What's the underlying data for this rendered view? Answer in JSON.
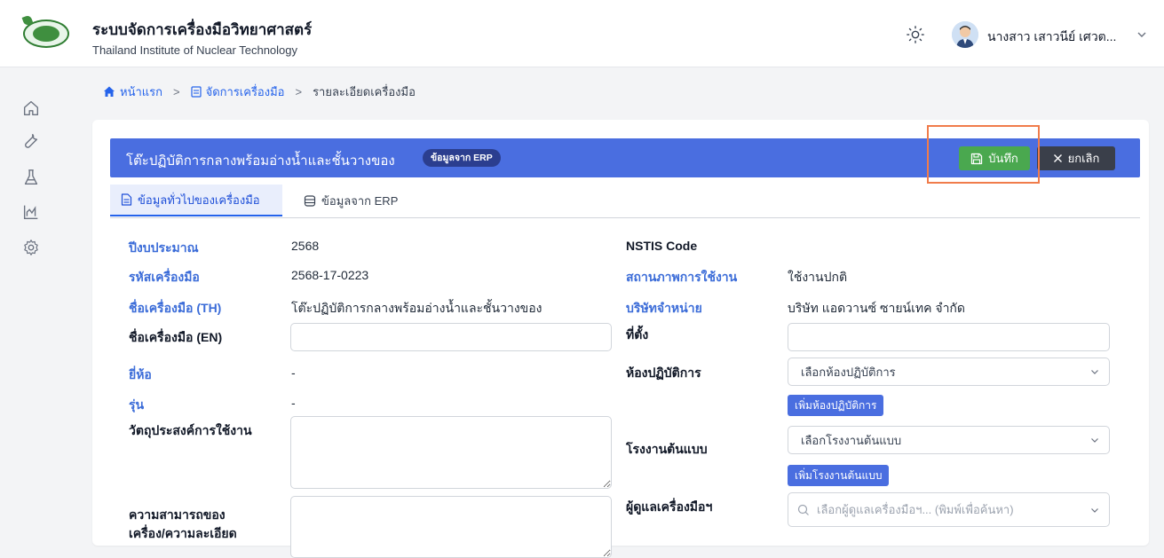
{
  "app": {
    "title": "ระบบจัดการเครื่องมือวิทยาศาสตร์",
    "subtitle": "Thailand Institute of Nuclear Technology",
    "user_name": "นางสาว เสาวนีย์ เศวต..."
  },
  "sidebar": {
    "icons": [
      "home-icon",
      "wrench-icon",
      "flask-icon",
      "chart-icon",
      "settings-icon"
    ]
  },
  "breadcrumb": {
    "home": "หน้าแรก",
    "manage": "จัดการเครื่องมือ",
    "current": "รายละเอียดเครื่องมือ"
  },
  "card": {
    "title": "โต๊ะปฏิบัติการกลางพร้อมอ่างน้ำและชั้นวางของ",
    "badge": "ข้อมูลจาก ERP",
    "save_label": "บันทึก",
    "cancel_label": "ยกเลิก"
  },
  "tabs": [
    {
      "label": "ข้อมูลทั่วไปของเครื่องมือ",
      "active": true
    },
    {
      "label": "ข้อมูลจาก ERP",
      "active": false
    }
  ],
  "left_fields": {
    "budget_year_label": "ปีงบประมาณ",
    "budget_year_value": "2568",
    "tool_code_label": "รหัสเครื่องมือ",
    "tool_code_value": "2568-17-0223",
    "name_th_label": "ชื่อเครื่องมือ (TH)",
    "name_th_value": "โต๊ะปฏิบัติการกลางพร้อมอ่างน้ำและชั้นวางของ",
    "name_en_label": "ชื่อเครื่องมือ (EN)",
    "name_en_value": "",
    "brand_label": "ยี่ห้อ",
    "brand_value": "-",
    "model_label": "รุ่น",
    "model_value": "-",
    "purpose_label": "วัตถุประสงค์การใช้งาน",
    "purpose_value": "",
    "capability_label_line1": "ความสามารถของ",
    "capability_label_line2": "เครื่อง/ความละเอียด"
  },
  "right_fields": {
    "nstis_label": "NSTIS Code",
    "nstis_value": "",
    "status_label": "สถานภาพการใช้งาน",
    "status_value": "ใช้งานปกติ",
    "vendor_label": "บริษัทจำหน่าย",
    "vendor_value": "บริษัท แอดวานซ์ ซายน์เทค จำกัด",
    "location_label": "ที่ตั้ง",
    "location_value": "",
    "lab_label": "ห้องปฏิบัติการ",
    "lab_select": "เลือกห้องปฏิบัติการ",
    "lab_add": "เพิ่มห้องปฏิบัติการ",
    "factory_label": "โรงงานต้นแบบ",
    "factory_select": "เลือกโรงงานต้นแบบ",
    "factory_add": "เพิ่มโรงงานต้นแบบ",
    "caretaker_label": "ผู้ดูแลเครื่องมือฯ",
    "caretaker_placeholder": "เลือกผู้ดูแลเครื่องมือฯ... (พิมพ์เพื่อค้นหา)"
  },
  "colors": {
    "primary": "#4a6ee0",
    "save": "#4aa84f",
    "cancel": "#3a3f4a",
    "label_blue": "#3b6cd8",
    "highlight": "#f07c4b"
  }
}
